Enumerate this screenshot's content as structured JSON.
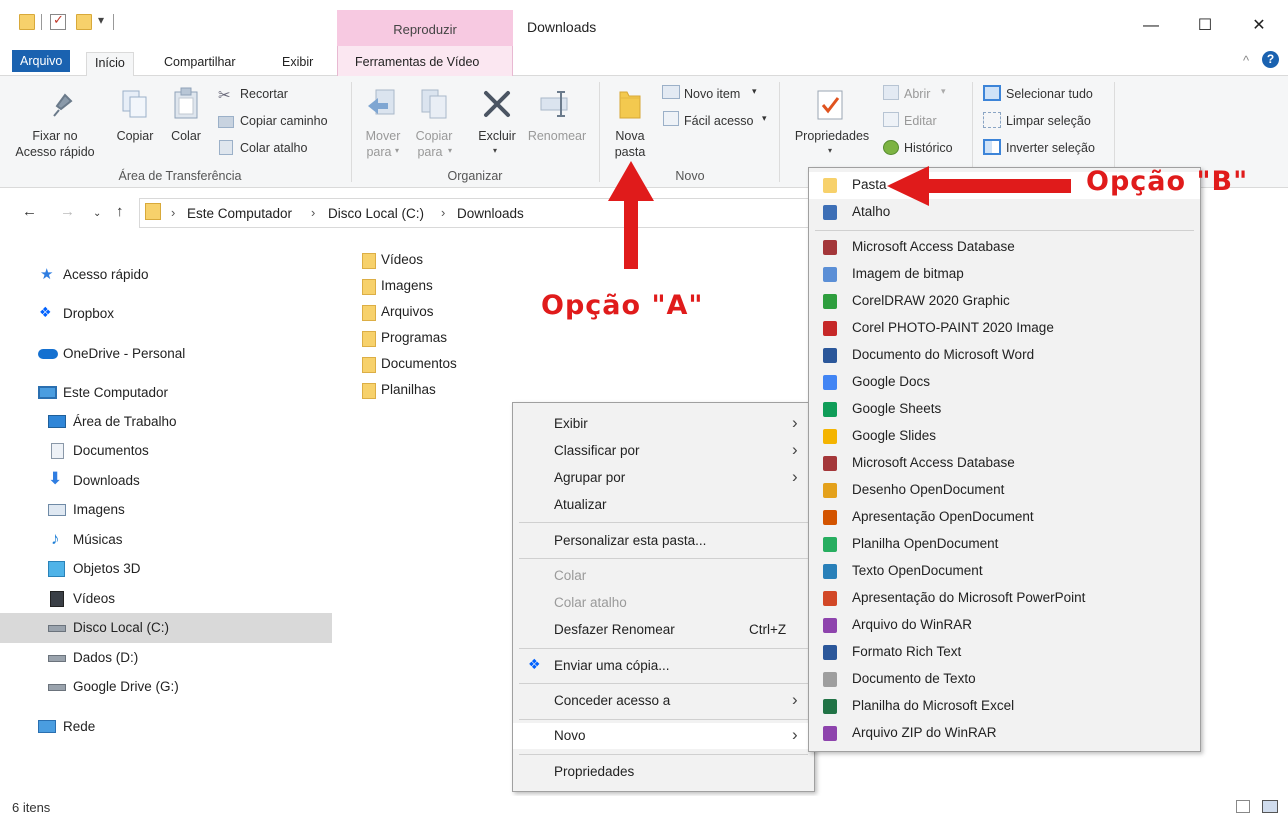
{
  "window": {
    "title": "Downloads",
    "contextual_tab_group": "Reproduzir",
    "minimize_glyph": "—",
    "maximize_glyph": "☐",
    "close_glyph": "✕"
  },
  "tabs": [
    {
      "label": "Arquivo"
    },
    {
      "label": "Início"
    },
    {
      "label": "Compartilhar"
    },
    {
      "label": "Exibir"
    },
    {
      "label": "Ferramentas de Vídeo"
    }
  ],
  "ribbon": {
    "clipboard": {
      "pin_line1": "Fixar no",
      "pin_line2": "Acesso rápido",
      "copy": "Copiar",
      "paste": "Colar",
      "cut": "Recortar",
      "copy_path": "Copiar caminho",
      "paste_shortcut": "Colar atalho",
      "group": "Área de Transferência"
    },
    "organize": {
      "move_line1": "Mover",
      "move_line2": "para",
      "copyto_line1": "Copiar",
      "copyto_line2": "para",
      "delete": "Excluir",
      "rename": "Renomear",
      "group": "Organizar"
    },
    "new": {
      "new_folder_line1": "Nova",
      "new_folder_line2": "pasta",
      "new_item": "Novo item",
      "easy_access": "Fácil acesso",
      "group": "Novo"
    },
    "open": {
      "properties": "Propriedades",
      "open": "Abrir",
      "edit": "Editar",
      "history": "Histórico"
    },
    "select": {
      "select_all": "Selecionar tudo",
      "select_none": "Limpar seleção",
      "invert": "Inverter seleção"
    }
  },
  "address": {
    "crumbs": [
      "Este Computador",
      "Disco Local (C:)",
      "Downloads"
    ]
  },
  "sidebar": [
    {
      "label": "Acesso rápido",
      "icon": "star-icon"
    },
    {
      "label": "Dropbox",
      "icon": "dropbox-icon"
    },
    {
      "label": "OneDrive - Personal",
      "icon": "cloud-icon"
    },
    {
      "label": "Este Computador",
      "icon": "computer-icon"
    },
    {
      "label": "Área de Trabalho",
      "icon": "desktop-icon"
    },
    {
      "label": "Documentos",
      "icon": "document-icon"
    },
    {
      "label": "Downloads",
      "icon": "download-icon"
    },
    {
      "label": "Imagens",
      "icon": "pictures-icon"
    },
    {
      "label": "Músicas",
      "icon": "music-icon"
    },
    {
      "label": "Objetos 3D",
      "icon": "cube-icon"
    },
    {
      "label": "Vídeos",
      "icon": "video-icon"
    },
    {
      "label": "Disco Local (C:)",
      "icon": "drive-icon"
    },
    {
      "label": "Dados (D:)",
      "icon": "drive-icon"
    },
    {
      "label": "Google Drive (G:)",
      "icon": "drive-icon"
    },
    {
      "label": "Rede",
      "icon": "network-icon"
    }
  ],
  "files": [
    "Vídeos",
    "Imagens",
    "Arquivos",
    "Programas",
    "Documentos",
    "Planilhas"
  ],
  "context_menu": {
    "view": "Exibir",
    "sort": "Classificar por",
    "group": "Agrupar por",
    "refresh": "Atualizar",
    "customize": "Personalizar esta pasta...",
    "paste": "Colar",
    "paste_shortcut": "Colar atalho",
    "undo": "Desfazer Renomear",
    "undo_shortcut": "Ctrl+Z",
    "send_copy": "Enviar uma cópia...",
    "give_access": "Conceder acesso a",
    "new": "Novo",
    "properties": "Propriedades"
  },
  "submenu": [
    {
      "label": "Pasta",
      "color": "#f7d16b"
    },
    {
      "label": "Atalho",
      "color": "#3d6fb6"
    },
    {
      "label": "Microsoft Access Database",
      "color": "#a4373a"
    },
    {
      "label": "Imagem de bitmap",
      "color": "#5b8fd6"
    },
    {
      "label": "CorelDRAW 2020 Graphic",
      "color": "#2e9e3e"
    },
    {
      "label": "Corel PHOTO-PAINT 2020 Image",
      "color": "#c62828"
    },
    {
      "label": "Documento do Microsoft Word",
      "color": "#2b579a"
    },
    {
      "label": "Google Docs",
      "color": "#4285f4"
    },
    {
      "label": "Google Sheets",
      "color": "#0f9d58"
    },
    {
      "label": "Google Slides",
      "color": "#f4b400"
    },
    {
      "label": "Microsoft Access Database",
      "color": "#a4373a"
    },
    {
      "label": "Desenho OpenDocument",
      "color": "#e4a11b"
    },
    {
      "label": "Apresentação OpenDocument",
      "color": "#d35400"
    },
    {
      "label": "Planilha OpenDocument",
      "color": "#27ae60"
    },
    {
      "label": "Texto OpenDocument",
      "color": "#2980b9"
    },
    {
      "label": "Apresentação do Microsoft PowerPoint",
      "color": "#d24726"
    },
    {
      "label": "Arquivo do WinRAR",
      "color": "#8e44ad"
    },
    {
      "label": "Formato Rich Text",
      "color": "#2b579a"
    },
    {
      "label": "Documento de Texto",
      "color": "#9e9e9e"
    },
    {
      "label": "Planilha do Microsoft Excel",
      "color": "#217346"
    },
    {
      "label": "Arquivo ZIP do WinRAR",
      "color": "#8e44ad"
    }
  ],
  "annotations": {
    "option_a": "Opção \"A\"",
    "option_b": "Opção \"B\"",
    "color": "#e01b1b"
  },
  "status": {
    "count": "6 itens"
  }
}
